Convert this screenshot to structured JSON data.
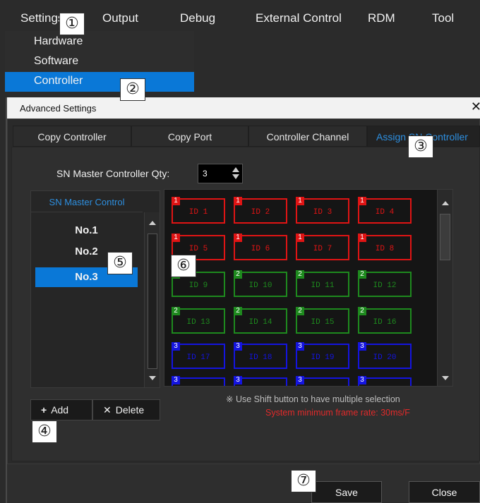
{
  "menu": {
    "items": [
      "Settings",
      "Output",
      "Debug",
      "External Control",
      "RDM",
      "Tool"
    ]
  },
  "dropdown": {
    "items": [
      "Hardware",
      "Software",
      "Controller"
    ]
  },
  "callouts": [
    "①",
    "②",
    "③",
    "④",
    "⑤",
    "⑥",
    "⑦"
  ],
  "dialog": {
    "title": "Advanced Settings",
    "close_glyph": "✕",
    "tabs": [
      "Copy Controller",
      "Copy Port",
      "Controller Channel",
      "Assign SN Controller"
    ],
    "qty_label": "SN Master Controller Qty:",
    "qty_value": "3",
    "list_header": "SN Master Control",
    "list_items": [
      "No.1",
      "No.2",
      "No.3"
    ],
    "grid_cells": [
      {
        "label": "ID 1",
        "group": "1"
      },
      {
        "label": "ID 2",
        "group": "1"
      },
      {
        "label": "ID 3",
        "group": "1"
      },
      {
        "label": "ID 4",
        "group": "1"
      },
      {
        "label": "ID 5",
        "group": "1"
      },
      {
        "label": "ID 6",
        "group": "1"
      },
      {
        "label": "ID 7",
        "group": "1"
      },
      {
        "label": "ID 8",
        "group": "1"
      },
      {
        "label": "ID 9",
        "group": "2"
      },
      {
        "label": "ID 10",
        "group": "2"
      },
      {
        "label": "ID 11",
        "group": "2"
      },
      {
        "label": "ID 12",
        "group": "2"
      },
      {
        "label": "ID 13",
        "group": "2"
      },
      {
        "label": "ID 14",
        "group": "2"
      },
      {
        "label": "ID 15",
        "group": "2"
      },
      {
        "label": "ID 16",
        "group": "2"
      },
      {
        "label": "ID 17",
        "group": "3"
      },
      {
        "label": "ID 18",
        "group": "3"
      },
      {
        "label": "ID 19",
        "group": "3"
      },
      {
        "label": "ID 20",
        "group": "3"
      },
      {
        "label": "",
        "group": "3"
      },
      {
        "label": "",
        "group": "3"
      },
      {
        "label": "",
        "group": "3"
      },
      {
        "label": "",
        "group": "3"
      }
    ],
    "hint": "※ Use Shift button to have multiple selection",
    "frame_rate": "System minimum frame rate: 30ms/F",
    "add_icon": "+",
    "add_label": "Add",
    "delete_icon": "✕",
    "delete_label": "Delete",
    "save_label": "Save",
    "close_label": "Close"
  },
  "colors": {
    "accent": "#0a78d7",
    "tab_active": "#2d8fe0",
    "group1": "#e01414",
    "group2": "#1e8a1e",
    "group3": "#1414e0",
    "warning": "#e12a2a"
  }
}
